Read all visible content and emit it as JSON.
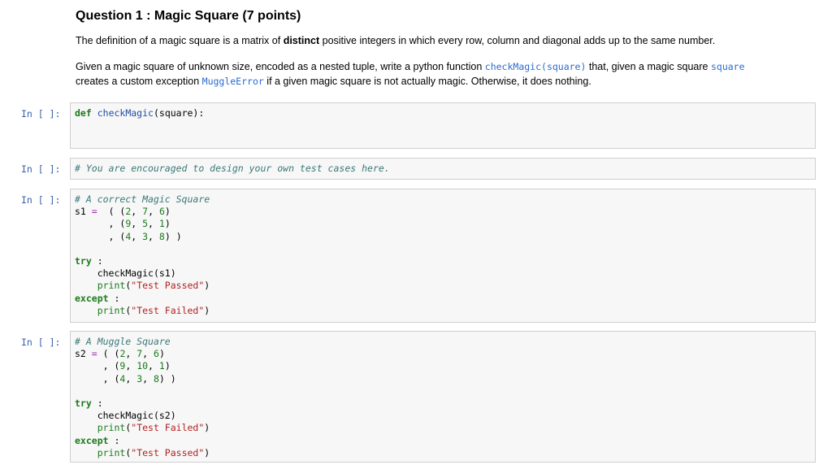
{
  "question": {
    "title": "Question 1 : Magic Square (7 points)",
    "p1_before": "The definition of a magic square is a matrix of ",
    "p1_bold": "distinct",
    "p1_after": " positive integers in which every row, column and diagonal adds up to the same number.",
    "p2_part1": "Given a magic square of unknown size, encoded as a nested tuple, write a python function ",
    "p2_code1": "checkMagic(square)",
    "p2_part2": " that, given a magic square ",
    "p2_code2": "square",
    "p2_part3": "creates a custom exception ",
    "p2_code3": "MuggleError",
    "p2_part4": " if a given magic square is not actually magic. Otherwise, it does nothing."
  },
  "prompt_label": "In [ ]:",
  "cell1": {
    "def_kw": "def",
    "fn_name": "checkMagic",
    "rest": "(square):"
  },
  "cell2": {
    "comment": "# You are encouraged to design your own test cases here."
  },
  "cell3": {
    "comment": "# A correct Magic Square",
    "var": "s1",
    "rows": [
      [
        "2",
        "7",
        "6"
      ],
      [
        "9",
        "5",
        "1"
      ],
      [
        "4",
        "3",
        "8"
      ]
    ],
    "try_kw": "try",
    "call": "checkMagic(s1)",
    "print_fn": "print",
    "pass_str": "\"Test Passed\"",
    "except_kw": "except",
    "fail_str": "\"Test Failed\""
  },
  "cell4": {
    "comment": "# A Muggle Square",
    "var": "s2",
    "rows": [
      [
        "2",
        "7",
        "6"
      ],
      [
        "9",
        "10",
        "1"
      ],
      [
        "4",
        "3",
        "8"
      ]
    ],
    "try_kw": "try",
    "call": "checkMagic(s2)",
    "print_fn": "print",
    "fail_str": "\"Test Failed\"",
    "except_kw": "except",
    "pass_str": "\"Test Passed\""
  }
}
